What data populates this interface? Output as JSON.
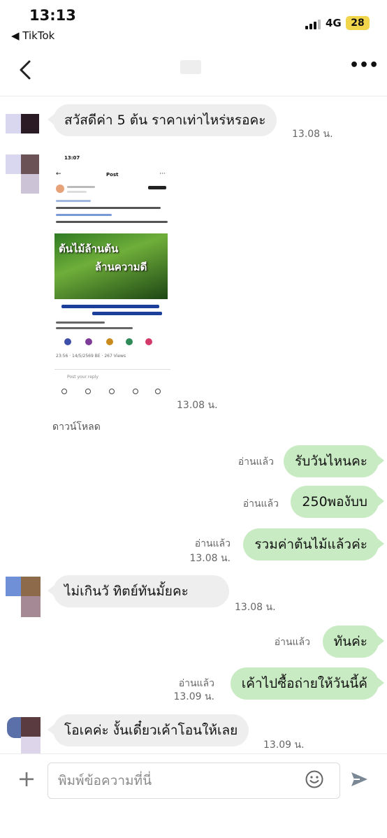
{
  "status_bar": {
    "time": "13:13",
    "back_app": "◀ TikTok",
    "network": "4G",
    "battery": "28"
  },
  "header": {
    "more": "•••"
  },
  "messages": [
    {
      "direction": "in",
      "text": "สวัสดีค่า 5 ต้น ราคาเท่าไหร่หรอคะ",
      "time": "13.08 น."
    },
    {
      "direction": "in",
      "type": "image",
      "time": "13.08 น.",
      "caption": "ดาวน์โหลด"
    },
    {
      "direction": "out",
      "text": "รับวันไหนคะ",
      "read": "อ่านแล้ว"
    },
    {
      "direction": "out",
      "text": "250พองับบ",
      "read": "อ่านแล้ว"
    },
    {
      "direction": "out",
      "text": "รวมค่าต้นไม้แล้วค่ะ",
      "read": "อ่านแล้ว",
      "time": "13.08 น."
    },
    {
      "direction": "in",
      "text": "ไม่เกินวั  ทิตย์ทันมั้ยคะ",
      "time": "13.08 น."
    },
    {
      "direction": "out",
      "text": "ทันค่ะ",
      "read": "อ่านแล้ว"
    },
    {
      "direction": "out",
      "text": "เค้าไปซื้อถ่ายให้วันนี้ค้",
      "read": "อ่านแล้ว",
      "time": "13.09 น."
    },
    {
      "direction": "in",
      "text": "โอเคค่ะ งั้นเดี๋ยวเค้าโอนให้เลย",
      "time": "13.09 น."
    }
  ],
  "shared_image": {
    "status_time": "13:07",
    "post_title": "Post",
    "banner_line1": "ต้นไม้ล้านต้น",
    "banner_line2": "ล้านความดี",
    "views": "23:56 · 14/5/2569 BE · 267 Views",
    "reply_placeholder": "Post your reply"
  },
  "input_bar": {
    "placeholder": "พิมพ์ข้อความที่นี่"
  },
  "colors": {
    "outgoing_bubble": "#c9ebc3",
    "incoming_bubble": "#eeeeef",
    "battery": "#f1d64c",
    "send_icon": "#7a8794"
  }
}
